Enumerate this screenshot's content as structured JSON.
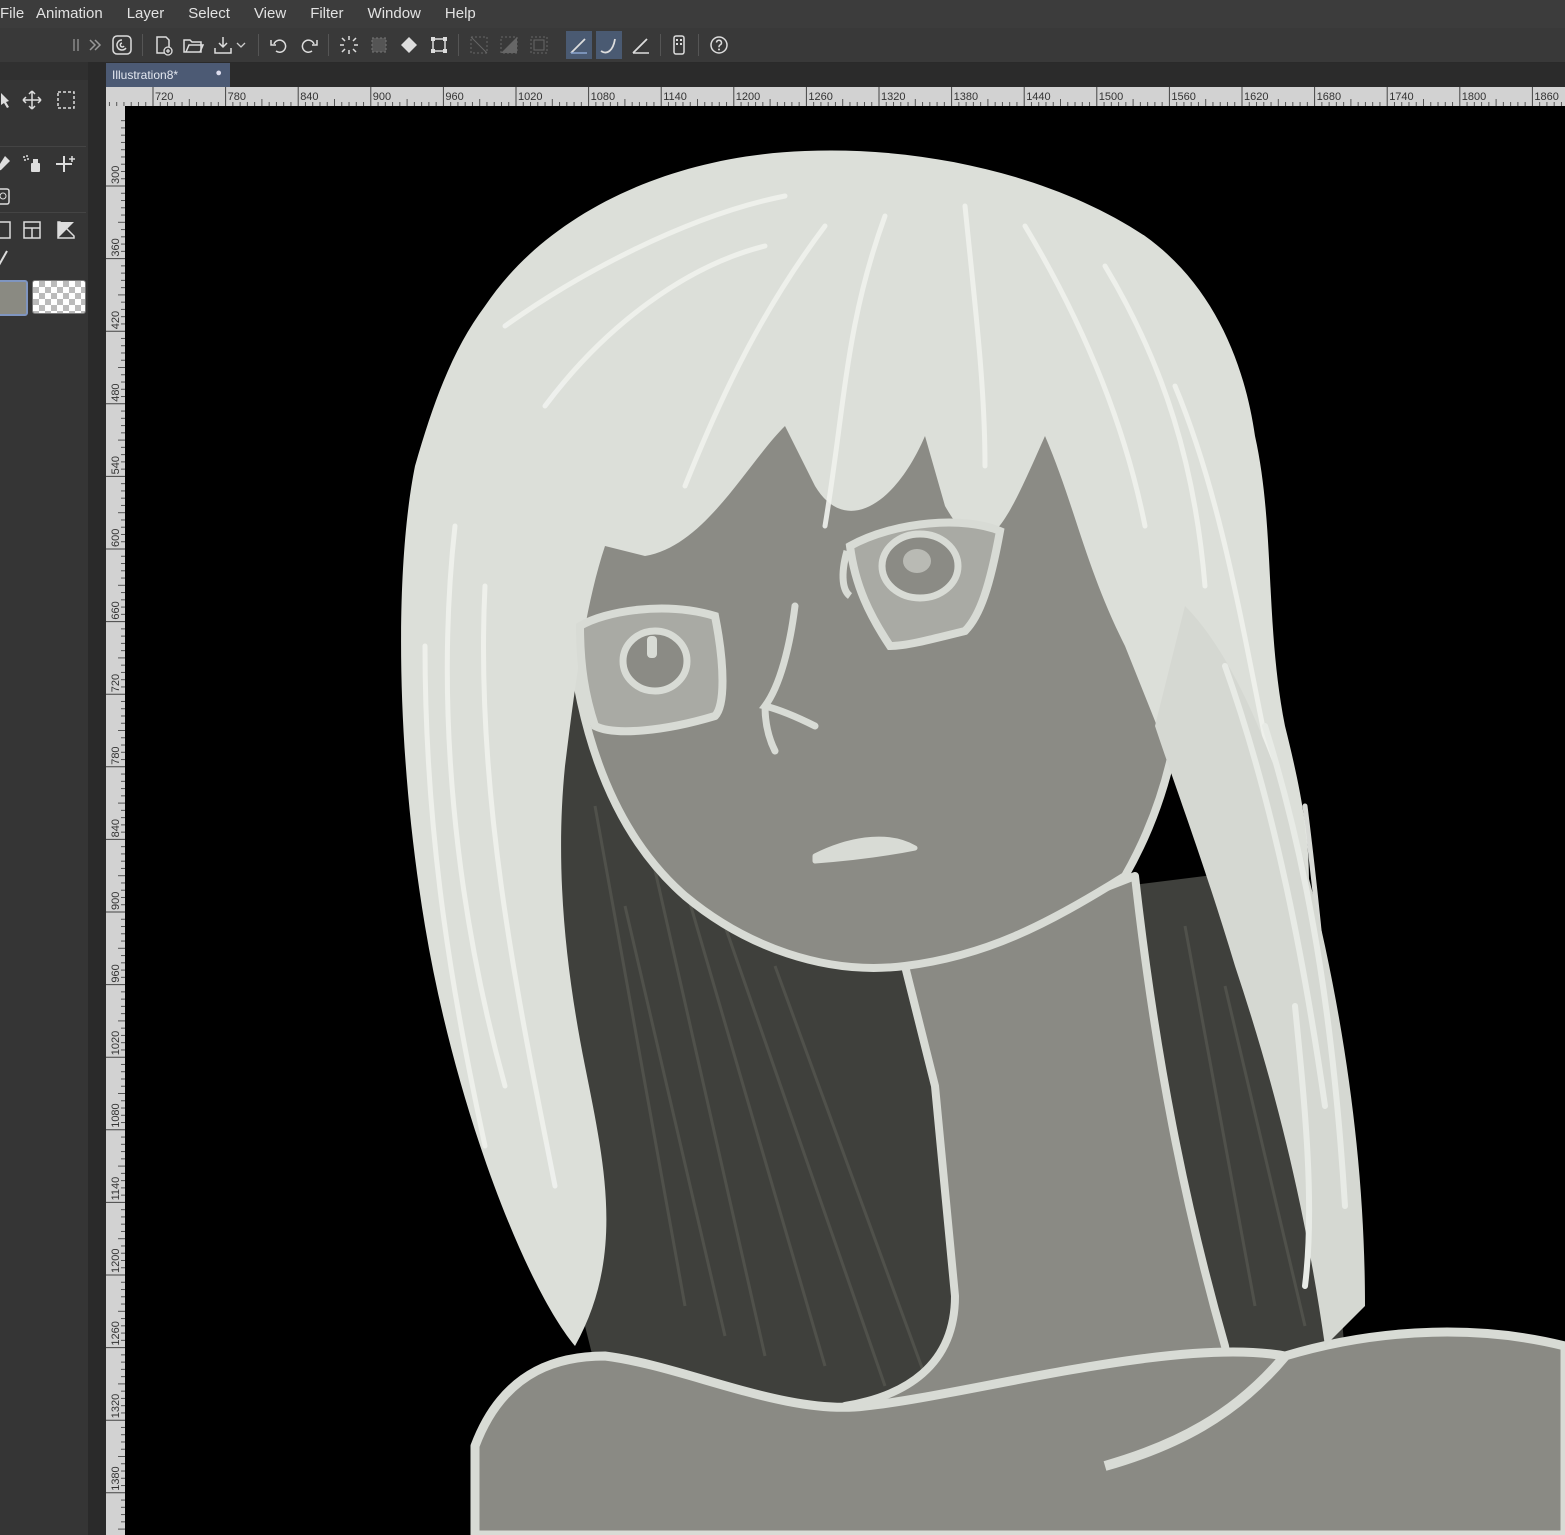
{
  "menu": {
    "items": [
      "File",
      "Animation",
      "Layer",
      "Select",
      "View",
      "Filter",
      "Window",
      "Help"
    ]
  },
  "toolbar": {
    "icons": [
      "clip-studio-icon",
      "new-file-icon",
      "open-file-icon",
      "export-icon",
      "undo-icon",
      "redo-icon",
      "clear-selection-icon",
      "fill-icon",
      "transform-icon",
      "snap-off-icon",
      "snap-ruler-icon",
      "snap-grid-icon",
      "snap-line-icon",
      "snap-curve-icon",
      "snap-perspective-icon",
      "smartphone-icon",
      "help-icon"
    ]
  },
  "document": {
    "tab_name": "Illustration8*",
    "tab_close": "●"
  },
  "ruler": {
    "horizontal_labels": [
      "720",
      "780",
      "840",
      "900",
      "960",
      "1020",
      "1080",
      "1140",
      "1200",
      "1260",
      "1320",
      "1380",
      "1440",
      "1500",
      "1560",
      "1620",
      "1680",
      "1740",
      "1800",
      "1860"
    ],
    "vertical_labels": [
      "300",
      "360",
      "420",
      "480",
      "540",
      "600",
      "660",
      "720",
      "780",
      "840",
      "900",
      "960",
      "1020",
      "1080",
      "1140",
      "1200",
      "1260",
      "1320",
      "1380"
    ]
  },
  "colors": {
    "main_color": "#8a8a82",
    "canvas_bg": "#000000",
    "hair": "#dfe2dc",
    "skin": "#8a8a84",
    "dark_hair": "#3d3e3a",
    "accent": "#4c5a74"
  }
}
